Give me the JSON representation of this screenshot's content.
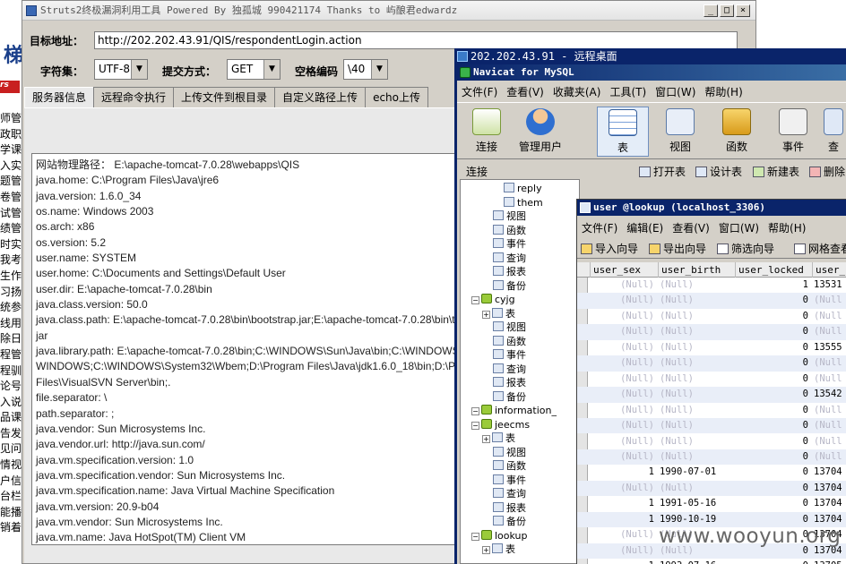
{
  "background_page": {
    "logo": "梯",
    "logo2": "rs",
    "items": [
      "师管",
      "政职",
      "学课",
      "入实",
      "题管",
      "卷管",
      "试管",
      "绩管",
      "时实",
      "我考",
      "生作",
      "习扬",
      "统参",
      "线用",
      "除日",
      "程管",
      "程驯",
      "论号",
      "入说",
      "品课",
      "告发",
      "见问",
      "情视",
      "户信",
      "台栏",
      "能播",
      "销着"
    ]
  },
  "struts_window": {
    "title": "Struts2终极漏洞利用工具  Powered By 独孤城 990421174 Thanks to 屿酿君edwardz",
    "url_label": "目标地址：",
    "url_value": "http://202.202.43.91/QIS/respondentLogin.action",
    "charset_label": "字符集：",
    "charset_value": "UTF-8",
    "method_label": "提交方式：",
    "method_value": "GET",
    "space_label": "空格编码",
    "space_value": "\\40",
    "tabs": [
      "服务器信息",
      "远程命令执行",
      "上传文件到根目录",
      "自定义路径上传",
      "echo上传"
    ],
    "info_lines": [
      "网站物理路径： E:\\apache-tomcat-7.0.28\\webapps\\QIS",
      "java.home: C:\\Program Files\\Java\\jre6",
      "java.version: 1.6.0_34",
      "os.name: Windows 2003",
      "os.arch: x86",
      "os.version: 5.2",
      "user.name: SYSTEM",
      "user.home: C:\\Documents and Settings\\Default User",
      "user.dir: E:\\apache-tomcat-7.0.28\\bin",
      "java.class.version: 50.0",
      "java.class.path: E:\\apache-tomcat-7.0.28\\bin\\bootstrap.jar;E:\\apache-tomcat-7.0.28\\bin\\to",
      "jar",
      "java.library.path: E:\\apache-tomcat-7.0.28\\bin;C:\\WINDOWS\\Sun\\Java\\bin;C:\\WINDOWS\\s",
      "WINDOWS;C:\\WINDOWS\\System32\\Wbem;D:\\Program Files\\Java\\jdk1.6.0_18\\bin;D:\\Pr",
      "Files\\VisualSVN Server\\bin;.",
      "file.separator: \\",
      "path.separator: ;",
      "java.vendor: Sun Microsystems Inc.",
      "java.vendor.url: http://java.sun.com/",
      "java.vm.specification.version: 1.0",
      "java.vm.specification.vendor: Sun Microsystems Inc.",
      "java.vm.specification.name: Java Virtual Machine Specification",
      "java.vm.version: 20.9-b04",
      "java.vm.vendor: Sun Microsystems Inc.",
      "java.vm.name: Java HotSpot(TM) Client VM"
    ]
  },
  "remote_desktop": {
    "title": "202.202.43.91 - 远程桌面"
  },
  "navicat": {
    "title": "Navicat for MySQL",
    "menu": [
      "文件(F)",
      "查看(V)",
      "收藏夹(A)",
      "工具(T)",
      "窗口(W)",
      "帮助(H)"
    ],
    "toolbar": [
      "连接",
      "管理用户",
      "表",
      "视图",
      "函数",
      "事件",
      "查"
    ],
    "subbar": {
      "connect": "连接",
      "open": "打开表",
      "design": "设计表",
      "new": "新建表",
      "delete": "删除"
    },
    "tree": [
      {
        "label": "reply",
        "indent": 4,
        "icon": "table"
      },
      {
        "label": "them",
        "indent": 4,
        "icon": "table"
      },
      {
        "label": "视图",
        "indent": 3,
        "icon": "view"
      },
      {
        "label": "函数",
        "indent": 3,
        "icon": "func"
      },
      {
        "label": "事件",
        "indent": 3,
        "icon": "event"
      },
      {
        "label": "查询",
        "indent": 3,
        "icon": "query"
      },
      {
        "label": "报表",
        "indent": 3,
        "icon": "report"
      },
      {
        "label": "备份",
        "indent": 3,
        "icon": "backup"
      },
      {
        "label": "cyjg",
        "indent": 1,
        "icon": "db"
      },
      {
        "label": "表",
        "indent": 2,
        "icon": "table"
      },
      {
        "label": "视图",
        "indent": 3,
        "icon": "view"
      },
      {
        "label": "函数",
        "indent": 3,
        "icon": "func"
      },
      {
        "label": "事件",
        "indent": 3,
        "icon": "event"
      },
      {
        "label": "查询",
        "indent": 3,
        "icon": "query"
      },
      {
        "label": "报表",
        "indent": 3,
        "icon": "report"
      },
      {
        "label": "备份",
        "indent": 3,
        "icon": "backup"
      },
      {
        "label": "information_",
        "indent": 1,
        "icon": "db"
      },
      {
        "label": "jeecms",
        "indent": 1,
        "icon": "db"
      },
      {
        "label": "表",
        "indent": 2,
        "icon": "table"
      },
      {
        "label": "视图",
        "indent": 3,
        "icon": "view"
      },
      {
        "label": "函数",
        "indent": 3,
        "icon": "func"
      },
      {
        "label": "事件",
        "indent": 3,
        "icon": "event"
      },
      {
        "label": "查询",
        "indent": 3,
        "icon": "query"
      },
      {
        "label": "报表",
        "indent": 3,
        "icon": "report"
      },
      {
        "label": "备份",
        "indent": 3,
        "icon": "backup"
      },
      {
        "label": "lookup",
        "indent": 1,
        "icon": "db"
      },
      {
        "label": "表",
        "indent": 2,
        "icon": "table"
      }
    ]
  },
  "table_window": {
    "title": "user @lookup (localhost_3306)",
    "menu": [
      "文件(F)",
      "编辑(E)",
      "查看(V)",
      "窗口(W)",
      "帮助(H)"
    ],
    "toolbar": [
      "导入向导",
      "导出向导",
      "筛选向导",
      "网格查看"
    ],
    "columns": [
      "user_sex",
      "user_birth",
      "user_locked",
      "user_"
    ],
    "rows": [
      [
        "(Null)",
        "(Null)",
        "1",
        "13531"
      ],
      [
        "(Null)",
        "(Null)",
        "0",
        "(Null"
      ],
      [
        "(Null)",
        "(Null)",
        "0",
        "(Null"
      ],
      [
        "(Null)",
        "(Null)",
        "0",
        "(Null"
      ],
      [
        "(Null)",
        "(Null)",
        "0",
        "13555"
      ],
      [
        "(Null)",
        "(Null)",
        "0",
        "(Null"
      ],
      [
        "(Null)",
        "(Null)",
        "0",
        "(Null"
      ],
      [
        "(Null)",
        "(Null)",
        "0",
        "13542"
      ],
      [
        "(Null)",
        "(Null)",
        "0",
        "(Null"
      ],
      [
        "(Null)",
        "(Null)",
        "0",
        "(Null"
      ],
      [
        "(Null)",
        "(Null)",
        "0",
        "(Null"
      ],
      [
        "(Null)",
        "(Null)",
        "0",
        "(Null"
      ],
      [
        "1",
        "1990-07-01",
        "0",
        "13704"
      ],
      [
        "(Null)",
        "(Null)",
        "0",
        "13704"
      ],
      [
        "1",
        "1991-05-16",
        "0",
        "13704"
      ],
      [
        "1",
        "1990-10-19",
        "0",
        "13704"
      ],
      [
        "(Null)",
        "(Null)",
        "0",
        "13704"
      ],
      [
        "(Null)",
        "(Null)",
        "0",
        "13704"
      ],
      [
        "1",
        "1993-07-16",
        "0",
        "13705"
      ]
    ]
  },
  "watermark": "www.wooyun.org"
}
